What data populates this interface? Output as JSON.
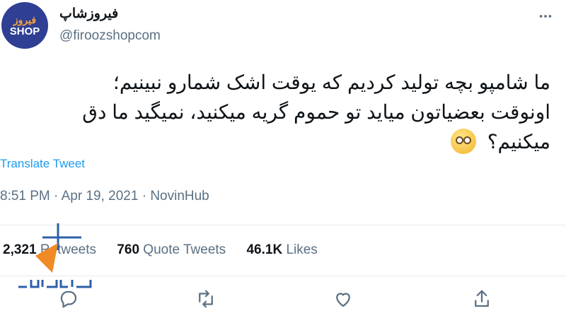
{
  "author": {
    "avatar_text_fa": "فيروز",
    "avatar_text_en": "SHOP",
    "display_name": "فيروزشاپ",
    "handle": "@firoozshopcom"
  },
  "tweet": {
    "lines": [
      "ما شامپو بچه تولید کردیم که یوقت اشک شمارو نبینیم؛",
      "اونوقت بعضیاتون میاید تو حموم گریه میکنید، نمیگید ما دق",
      "میکنیم؟"
    ]
  },
  "translate_label": "Translate Tweet",
  "meta": {
    "time": "8:51 PM",
    "date": "Apr 19, 2021",
    "source": "NovinHub"
  },
  "stats": {
    "retweets_count": "2,321",
    "retweets_label": "Retweets",
    "quotes_count": "760",
    "quotes_label": "Quote Tweets",
    "likes_count": "46.1K",
    "likes_label": "Likes"
  },
  "icons": {
    "more": "more-icon",
    "reply": "reply-icon",
    "retweet": "retweet-icon",
    "like": "like-icon",
    "share": "share-icon",
    "emoji": "rolling-eyes-emoji"
  },
  "colors": {
    "link": "#1d9bf0",
    "muted": "#5b7083",
    "avatar_bg": "#2f3f93",
    "watermark_orange": "#f08a24",
    "watermark_blue": "#2d5fa8"
  }
}
